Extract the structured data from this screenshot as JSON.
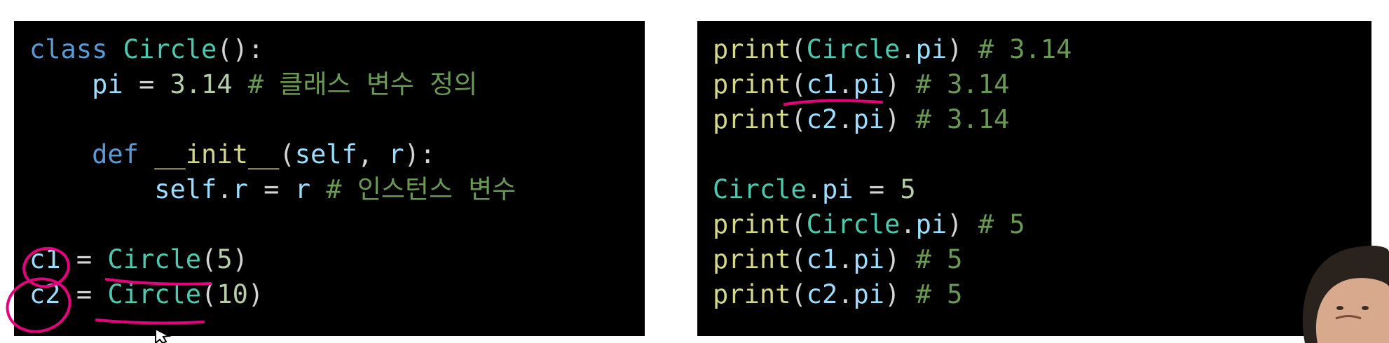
{
  "colors": {
    "background": "#ffffff",
    "code_background": "#000000",
    "keyword": "#5b9bd5",
    "function": "#d4d68a",
    "class_name": "#4ec9b0",
    "number": "#b5cea8",
    "variable": "#9cdcfe",
    "comment": "#6a9955",
    "annotation": "#e6007e"
  },
  "left_code": [
    [
      {
        "t": "class",
        "k": "kw"
      },
      {
        "t": " ",
        "k": "plain"
      },
      {
        "t": "Circle",
        "k": "cls"
      },
      {
        "t": "():",
        "k": "plain"
      }
    ],
    [
      {
        "t": "    ",
        "k": "plain"
      },
      {
        "t": "pi",
        "k": "var"
      },
      {
        "t": " = ",
        "k": "op"
      },
      {
        "t": "3.14",
        "k": "num"
      },
      {
        "t": " # 클래스 변수 정의",
        "k": "cmt"
      }
    ],
    [],
    [
      {
        "t": "    ",
        "k": "plain"
      },
      {
        "t": "def",
        "k": "kw"
      },
      {
        "t": " ",
        "k": "plain"
      },
      {
        "t": "__init__",
        "k": "fn"
      },
      {
        "t": "(",
        "k": "plain"
      },
      {
        "t": "self",
        "k": "var"
      },
      {
        "t": ", ",
        "k": "plain"
      },
      {
        "t": "r",
        "k": "var"
      },
      {
        "t": "):",
        "k": "plain"
      }
    ],
    [
      {
        "t": "        ",
        "k": "plain"
      },
      {
        "t": "self",
        "k": "var"
      },
      {
        "t": ".",
        "k": "plain"
      },
      {
        "t": "r",
        "k": "var"
      },
      {
        "t": " = ",
        "k": "op"
      },
      {
        "t": "r",
        "k": "var"
      },
      {
        "t": " # 인스턴스 변수",
        "k": "cmt"
      }
    ],
    [],
    [
      {
        "t": "c1",
        "k": "var"
      },
      {
        "t": " = ",
        "k": "op"
      },
      {
        "t": "Circle",
        "k": "cls"
      },
      {
        "t": "(",
        "k": "plain"
      },
      {
        "t": "5",
        "k": "num"
      },
      {
        "t": ")",
        "k": "plain"
      }
    ],
    [
      {
        "t": "c2",
        "k": "var"
      },
      {
        "t": " = ",
        "k": "op"
      },
      {
        "t": "Circle",
        "k": "cls"
      },
      {
        "t": "(",
        "k": "plain"
      },
      {
        "t": "10",
        "k": "num"
      },
      {
        "t": ")",
        "k": "plain"
      }
    ]
  ],
  "right_code": [
    [
      {
        "t": "print",
        "k": "fn"
      },
      {
        "t": "(",
        "k": "plain"
      },
      {
        "t": "Circle",
        "k": "cls"
      },
      {
        "t": ".",
        "k": "plain"
      },
      {
        "t": "pi",
        "k": "var"
      },
      {
        "t": ")",
        "k": "plain"
      },
      {
        "t": " # 3.14",
        "k": "cmt"
      }
    ],
    [
      {
        "t": "print",
        "k": "fn"
      },
      {
        "t": "(",
        "k": "plain"
      },
      {
        "t": "c1",
        "k": "var"
      },
      {
        "t": ".",
        "k": "plain"
      },
      {
        "t": "pi",
        "k": "var"
      },
      {
        "t": ")",
        "k": "plain"
      },
      {
        "t": " # 3.14",
        "k": "cmt"
      }
    ],
    [
      {
        "t": "print",
        "k": "fn"
      },
      {
        "t": "(",
        "k": "plain"
      },
      {
        "t": "c2",
        "k": "var"
      },
      {
        "t": ".",
        "k": "plain"
      },
      {
        "t": "pi",
        "k": "var"
      },
      {
        "t": ")",
        "k": "plain"
      },
      {
        "t": " # 3.14",
        "k": "cmt"
      }
    ],
    [],
    [
      {
        "t": "Circle",
        "k": "cls"
      },
      {
        "t": ".",
        "k": "plain"
      },
      {
        "t": "pi",
        "k": "var"
      },
      {
        "t": " = ",
        "k": "op"
      },
      {
        "t": "5",
        "k": "num"
      }
    ],
    [
      {
        "t": "print",
        "k": "fn"
      },
      {
        "t": "(",
        "k": "plain"
      },
      {
        "t": "Circle",
        "k": "cls"
      },
      {
        "t": ".",
        "k": "plain"
      },
      {
        "t": "pi",
        "k": "var"
      },
      {
        "t": ")",
        "k": "plain"
      },
      {
        "t": " # 5",
        "k": "cmt"
      }
    ],
    [
      {
        "t": "print",
        "k": "fn"
      },
      {
        "t": "(",
        "k": "plain"
      },
      {
        "t": "c1",
        "k": "var"
      },
      {
        "t": ".",
        "k": "plain"
      },
      {
        "t": "pi",
        "k": "var"
      },
      {
        "t": ")",
        "k": "plain"
      },
      {
        "t": " # 5",
        "k": "cmt"
      }
    ],
    [
      {
        "t": "print",
        "k": "fn"
      },
      {
        "t": "(",
        "k": "plain"
      },
      {
        "t": "c2",
        "k": "var"
      },
      {
        "t": ".",
        "k": "plain"
      },
      {
        "t": "pi",
        "k": "var"
      },
      {
        "t": ")",
        "k": "plain"
      },
      {
        "t": " # 5",
        "k": "cmt"
      }
    ]
  ],
  "annotations": [
    {
      "kind": "circle",
      "target": "c1"
    },
    {
      "kind": "circle",
      "target": "c2"
    },
    {
      "kind": "underline",
      "target": "Circle(5)"
    },
    {
      "kind": "underline",
      "target": "Circle(10)"
    },
    {
      "kind": "underline",
      "target": "c1.pi"
    }
  ],
  "icons": {
    "cursor": "mouse-pointer-icon",
    "presenter": "presenter-webcam-image"
  }
}
